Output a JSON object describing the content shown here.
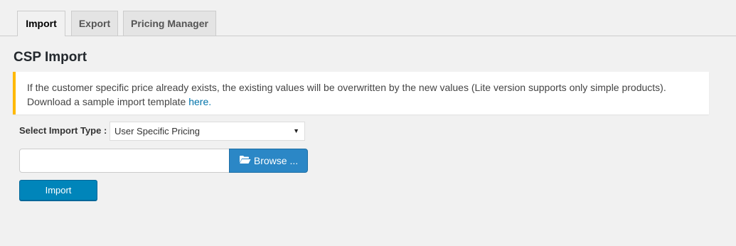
{
  "tabs": [
    {
      "label": "Import",
      "active": true
    },
    {
      "label": "Export",
      "active": false
    },
    {
      "label": "Pricing Manager",
      "active": false
    }
  ],
  "page": {
    "title": "CSP Import"
  },
  "notice": {
    "line1": "If the customer specific price already exists, the existing values will be overwritten by the new values (Lite version supports only simple products).",
    "line2_prefix": "Download a sample import template ",
    "link": "here.",
    "border_color": "#ffb900"
  },
  "import_type": {
    "label": "Select Import Type :",
    "selected": "User Specific Pricing"
  },
  "file": {
    "value": "",
    "browse_label": "Browse ...",
    "browse_icon": "folder-open-icon"
  },
  "actions": {
    "import_label": "Import"
  },
  "colors": {
    "accent": "#0085ba",
    "browse": "#2b87c6",
    "link": "#0073aa"
  }
}
